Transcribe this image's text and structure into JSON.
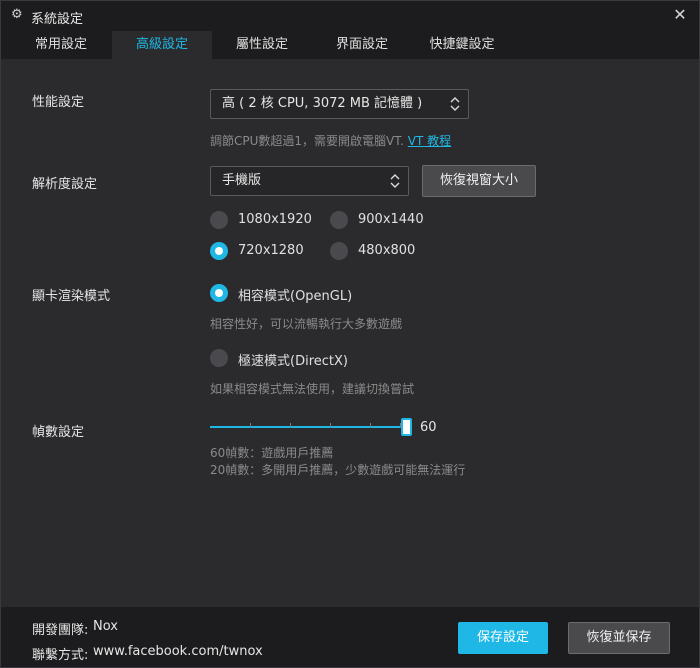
{
  "window": {
    "title": "系統設定",
    "icon": "gear-icon",
    "close_icon": "close-icon"
  },
  "tabs": [
    {
      "label": "常用設定",
      "active": false
    },
    {
      "label": "高級設定",
      "active": true
    },
    {
      "label": "屬性設定",
      "active": false
    },
    {
      "label": "界面設定",
      "active": false
    },
    {
      "label": "快捷鍵設定",
      "active": false
    }
  ],
  "performance": {
    "label": "性能設定",
    "selected": "高 ( 2 核 CPU, 3072 MB 記憶體 )",
    "hint_text": "調節CPU數超過1，需要開啟電腦VT.",
    "hint_link": "VT 教程"
  },
  "resolution": {
    "label": "解析度設定",
    "selected": "手機版",
    "restore_button": "恢復視窗大小",
    "options": [
      {
        "label": "1080x1920",
        "checked": false
      },
      {
        "label": "900x1440",
        "checked": false
      },
      {
        "label": "720x1280",
        "checked": true
      },
      {
        "label": "480x800",
        "checked": false
      }
    ]
  },
  "render": {
    "label": "顯卡渲染模式",
    "opengl_label": "相容模式(OpenGL)",
    "opengl_checked": true,
    "opengl_hint": "相容性好，可以流暢執行大多數遊戲",
    "directx_label": "極速模式(DirectX)",
    "directx_checked": false,
    "directx_hint": "如果相容模式無法使用，建議切換嘗試"
  },
  "fps": {
    "label": "幀數設定",
    "value": "60",
    "level": 1.0,
    "hint_1": "60幀數：遊戲用戶推薦",
    "hint_2": "20幀數：多開用戶推薦，少數遊戲可能無法運行"
  },
  "footer": {
    "dev_label": "開發團隊:",
    "dev_value": "Nox",
    "contact_label": "聯繫方式:",
    "contact_value": "www.facebook.com/twnox",
    "save_button": "保存設定",
    "restore_save_button": "恢復並保存"
  },
  "colors": {
    "accent": "#1fb8e6",
    "background": "#2b2b2e",
    "bar": "#1c1c1e"
  }
}
